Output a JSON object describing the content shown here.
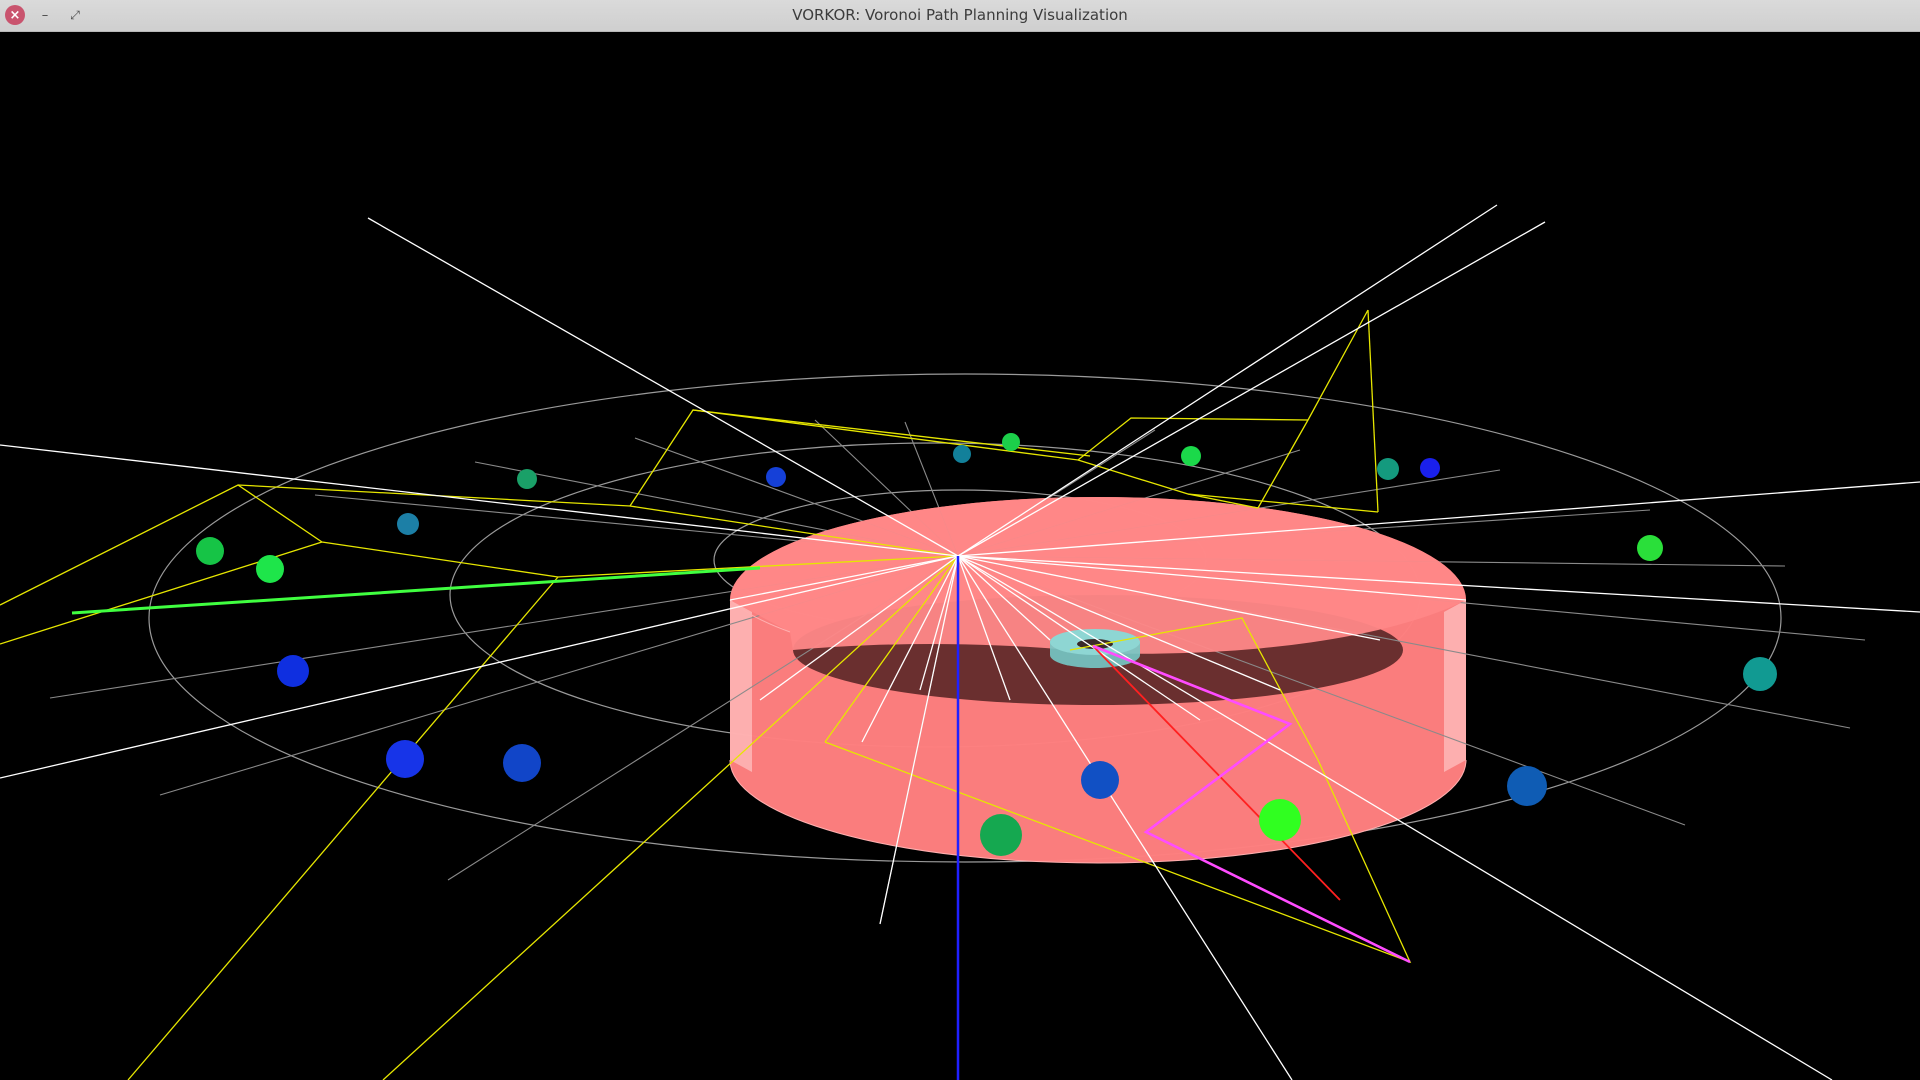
{
  "window": {
    "title": "VORKOR: Voronoi Path Planning Visualization",
    "controls": {
      "close_icon": "close-icon",
      "minimize_icon": "minimize-icon",
      "maximize_icon": "maximize-icon"
    }
  },
  "scene": {
    "background": "#000000",
    "colors": {
      "obstacle": "#ff7f7f",
      "obstacle_dark": "#6a2f2f",
      "goal_ring": "#76c9c6",
      "voronoi": "#e6e600",
      "rays": "#ffffff",
      "grid_rings": "#9a9a9a",
      "path": "#ff4cff",
      "start_line": "#40ff40",
      "axis_vertical": "#2020ff",
      "axis_red": "#ff2020"
    },
    "sites": [
      {
        "color": "#16c446"
      },
      {
        "color": "#1ee54a"
      },
      {
        "color": "#1aa068"
      },
      {
        "color": "#1c7fa6"
      },
      {
        "color": "#0f2fe0"
      },
      {
        "color": "#12809a"
      },
      {
        "color": "#1ccf4a"
      },
      {
        "color": "#1bd94a"
      },
      {
        "color": "#1540d8"
      },
      {
        "color": "#149a7e"
      },
      {
        "color": "#1a20ec"
      },
      {
        "color": "#2adf3a"
      },
      {
        "color": "#1734e8"
      },
      {
        "color": "#1145c8"
      },
      {
        "color": "#1150c4"
      },
      {
        "color": "#15a850"
      },
      {
        "color": "#0f5cb4"
      },
      {
        "color": "#30ff20"
      },
      {
        "color": "#119a92"
      },
      {
        "color": "#1ad946"
      }
    ]
  }
}
